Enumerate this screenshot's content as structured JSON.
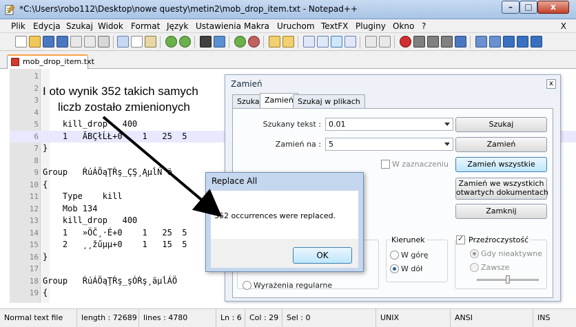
{
  "window": {
    "title": "*C:\\Users\\robo112\\Desktop\\nowe questy\\metin2\\mob_drop_item.txt - Notepad++",
    "min_label": "–",
    "max_label": "□",
    "close_label": "x"
  },
  "menu": {
    "items": [
      "Plik",
      "Edycja",
      "Szukaj",
      "Widok",
      "Format",
      "Język",
      "Ustawienia",
      "Makra",
      "Uruchom",
      "TextFX",
      "Pluginy",
      "Okno",
      "?"
    ],
    "close_label": "X"
  },
  "tab": {
    "label": "mob_drop_item.txt"
  },
  "editor": {
    "lines": [
      {
        "n": "1",
        "code": ""
      },
      {
        "n": "2",
        "code": ""
      },
      {
        "n": "3",
        "code": ""
      },
      {
        "n": "4",
        "code": ""
      },
      {
        "n": "5",
        "code": "    kill_drop   400"
      },
      {
        "n": "6",
        "code": "    1   ĂBÇłĹŁ+0    1   25  5"
      },
      {
        "n": "7",
        "code": "}"
      },
      {
        "n": "8",
        "code": ""
      },
      {
        "n": "9",
        "code": "Group   ŔúÁÖąŢŔş_ÇŞ¸ĄµĺŃ´ë"
      },
      {
        "n": "10",
        "code": "{"
      },
      {
        "n": "11",
        "code": "    Type    kill"
      },
      {
        "n": "12",
        "code": "    Mob 134"
      },
      {
        "n": "13",
        "code": "    kill_drop   400"
      },
      {
        "n": "14",
        "code": "    1   »ÖČ¸·É+0    1   25  5"
      },
      {
        "n": "15",
        "code": "    2   ¸¸žűµµ+0    1   15  5"
      },
      {
        "n": "16",
        "code": "}"
      },
      {
        "n": "17",
        "code": ""
      },
      {
        "n": "18",
        "code": "Group   ŔúÁÖąŢŔş_şÓŔş¸äµĺÁÖ"
      },
      {
        "n": "19",
        "code": "{"
      }
    ],
    "annotation_line1": "I oto wynik 352 takich samych",
    "annotation_line2": "liczb zostało zmienionych"
  },
  "replace_dialog": {
    "title": "Zamień",
    "close_label": "x",
    "tabs": [
      "Szukaj",
      "Zamień",
      "Szukaj w plikach"
    ],
    "find_label": "Szukany tekst :",
    "find_value": "0.01",
    "replace_label": "Zamień na :",
    "replace_value": "5",
    "in_selection_label": "W zaznaczeniu",
    "find_button": "Szukaj",
    "replace_button": "Zamień",
    "replace_all_button": "Zamień wszystkie",
    "replace_all_open_line1": "Zamień we wszystkich",
    "replace_all_open_line2": "otwartych dokumentach",
    "close_button": "Zamknij",
    "direction_title": "Kierunek",
    "direction_up": "W górę",
    "direction_down": "W dół",
    "regex_label": "Wyrażenia regularne",
    "transparency_title": "Przeźroczystość",
    "transparency_inactive": "Gdy nieaktywne",
    "transparency_always": "Zawsze"
  },
  "message_box": {
    "title": "Replace All",
    "text": "352 occurrences were replaced.",
    "ok_label": "OK"
  },
  "statusbar": {
    "type": "Normal text file",
    "length": "length : 72689",
    "lines": "lines : 4780",
    "ln": "Ln : 6",
    "col": "Col : 29",
    "sel": "Sel : 0",
    "eol": "UNIX",
    "encoding": "ANSI",
    "mode": "INS"
  },
  "colors": {
    "current_line": "#e8e8ff",
    "tab_accent": "#f8a14a",
    "title_bar": "#b9d1ee"
  }
}
